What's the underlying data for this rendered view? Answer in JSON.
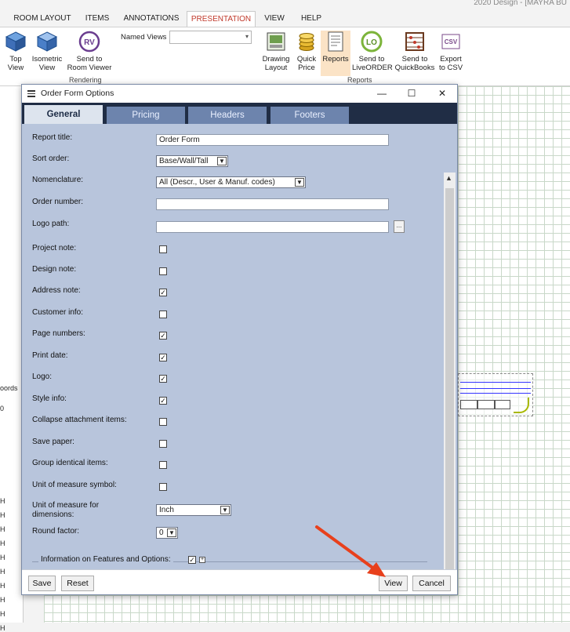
{
  "app": {
    "title": "2020 Design - [MAYRA BU"
  },
  "menu_tabs": [
    "ROOM LAYOUT",
    "ITEMS",
    "ANNOTATIONS",
    "PRESENTATION",
    "VIEW",
    "HELP"
  ],
  "ribbon": {
    "left_buttons": [
      {
        "label": "Top\nView",
        "icon": "cube-top-icon"
      },
      {
        "label": "Isometric\nView",
        "icon": "cube-iso-icon"
      },
      {
        "label": "Send to\nRoom Viewer",
        "icon": "rv-icon"
      }
    ],
    "named_views_label": "Named Views",
    "named_views_value": "",
    "rendering_group": "Rendering",
    "report_buttons": [
      {
        "label": "Drawing\nLayout",
        "icon": "drawing-layout-icon"
      },
      {
        "label": "Quick\nPrice",
        "icon": "coins-icon"
      },
      {
        "label": "Reports",
        "icon": "report-icon"
      },
      {
        "label": "Send to\nLiveORDER",
        "icon": "lo-icon"
      },
      {
        "label": "Send to\nQuickBooks",
        "icon": "abacus-icon"
      },
      {
        "label": "Export\nto CSV",
        "icon": "csv-icon"
      }
    ],
    "reports_group": "Reports"
  },
  "left_strip": {
    "coords_label": "oords",
    "value": "0",
    "rows": [
      "H",
      "H",
      "H",
      "H",
      "H",
      "H",
      "H",
      "H",
      "H",
      "H"
    ]
  },
  "dialog": {
    "title": "Order Form Options",
    "window_buttons": {
      "minimize": "—",
      "maximize": "☐",
      "close": "✕"
    },
    "tabs": [
      "General",
      "Pricing",
      "Headers",
      "Footers"
    ],
    "active_tab": "General",
    "fields": {
      "report_title": {
        "label": "Report title:",
        "value": "Order Form"
      },
      "sort_order": {
        "label": "Sort order:",
        "value": "Base/Wall/Tall"
      },
      "nomenclature": {
        "label": "Nomenclature:",
        "value": "All (Descr., User & Manuf. codes)"
      },
      "order_number": {
        "label": "Order number:",
        "value": ""
      },
      "logo_path": {
        "label": "Logo path:",
        "value": "",
        "browse": "..."
      }
    },
    "checkboxes": [
      {
        "label": "Project note:",
        "checked": false
      },
      {
        "label": "Design note:",
        "checked": false
      },
      {
        "label": "Address note:",
        "checked": true
      },
      {
        "label": "Customer info:",
        "checked": false
      },
      {
        "label": "Page numbers:",
        "checked": true
      },
      {
        "label": "Print date:",
        "checked": true
      },
      {
        "label": "Logo:",
        "checked": true
      },
      {
        "label": "Style info:",
        "checked": true
      },
      {
        "label": "Collapse attachment items:",
        "checked": false
      },
      {
        "label": "Save paper:",
        "checked": false
      },
      {
        "label": "Group identical items:",
        "checked": false
      },
      {
        "label": "Unit of measure symbol:",
        "checked": false
      }
    ],
    "unit_dimensions": {
      "label_line1": "Unit of measure for",
      "label_line2": "dimensions:",
      "value": "Inch"
    },
    "round_factor": {
      "label": "Round factor:",
      "value": "0"
    },
    "info_features": {
      "label": "Information on Features and Options:",
      "checked": true,
      "expand": "+"
    },
    "buttons": {
      "save": "Save",
      "reset": "Reset",
      "view": "View",
      "cancel": "Cancel"
    }
  },
  "check_mark": "✓",
  "colors": {
    "tab_bar": "#202d45",
    "tab": "#6d84ad",
    "panel": "#b8c5dc",
    "accent": "#c0392b",
    "arrow": "#e8401c"
  }
}
